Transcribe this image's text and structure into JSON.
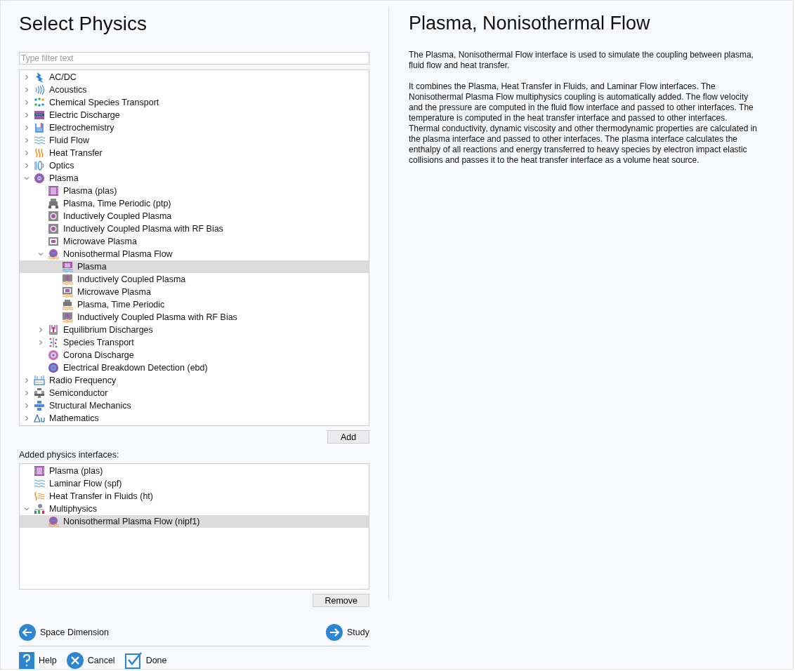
{
  "title": "Select Physics",
  "filter": {
    "placeholder": "Type filter text"
  },
  "tree": [
    {
      "label": "AC/DC",
      "kind": "bolt",
      "expanded": false,
      "selected": false
    },
    {
      "label": "Acoustics",
      "kind": "sound",
      "expanded": false,
      "selected": false
    },
    {
      "label": "Chemical Species Transport",
      "kind": "dots",
      "expanded": false,
      "selected": false
    },
    {
      "label": "Electric Discharge",
      "kind": "discharge",
      "expanded": false,
      "selected": false
    },
    {
      "label": "Electrochemistry",
      "kind": "beaker",
      "expanded": false,
      "selected": false
    },
    {
      "label": "Fluid Flow",
      "kind": "flow",
      "expanded": false,
      "selected": false
    },
    {
      "label": "Heat Transfer",
      "kind": "heat",
      "expanded": false,
      "selected": false
    },
    {
      "label": "Optics",
      "kind": "optics",
      "expanded": false,
      "selected": false
    },
    {
      "label": "Plasma",
      "kind": "plasma",
      "expanded": true,
      "selected": false,
      "children": [
        {
          "label": "Plasma (plas)",
          "kind": "chamber",
          "selected": false
        },
        {
          "label": "Plasma, Time Periodic (ptp)",
          "kind": "device",
          "selected": false
        },
        {
          "label": "Inductively Coupled Plasma",
          "kind": "coil",
          "selected": false
        },
        {
          "label": "Inductively Coupled Plasma with RF Bias",
          "kind": "coil",
          "selected": false
        },
        {
          "label": "Microwave Plasma",
          "kind": "microwave",
          "selected": false
        },
        {
          "label": "Nonisothermal Plasma Flow",
          "kind": "plasmaflow",
          "expanded": true,
          "selected": false,
          "children": [
            {
              "label": "Plasma",
              "kind": "chamberflow",
              "selected": true
            },
            {
              "label": "Inductively Coupled Plasma",
              "kind": "coilflow",
              "selected": false
            },
            {
              "label": "Microwave Plasma",
              "kind": "microwaveflow",
              "selected": false
            },
            {
              "label": "Plasma, Time Periodic",
              "kind": "deviceflow",
              "selected": false
            },
            {
              "label": "Inductively Coupled Plasma with RF Bias",
              "kind": "coilflow",
              "selected": false
            }
          ]
        },
        {
          "label": "Equilibrium Discharges",
          "kind": "torch",
          "expanded": false,
          "selected": false
        },
        {
          "label": "Species Transport",
          "kind": "species",
          "expanded": false,
          "selected": false
        },
        {
          "label": "Corona Discharge",
          "kind": "corona",
          "selected": false
        },
        {
          "label": "Electrical Breakdown Detection (ebd)",
          "kind": "breakdown",
          "selected": false
        }
      ]
    },
    {
      "label": "Radio Frequency",
      "kind": "antenna",
      "expanded": false,
      "selected": false
    },
    {
      "label": "Semiconductor",
      "kind": "transistor",
      "expanded": false,
      "selected": false
    },
    {
      "label": "Structural Mechanics",
      "kind": "beam",
      "expanded": false,
      "selected": false
    },
    {
      "label": "Mathematics",
      "kind": "delta",
      "expanded": false,
      "selected": false
    }
  ],
  "add_button": "Add",
  "added_label": "Added physics interfaces:",
  "added": [
    {
      "label": "Plasma (plas)",
      "kind": "chamber",
      "selected": false
    },
    {
      "label": "Laminar Flow (spf)",
      "kind": "flow",
      "selected": false
    },
    {
      "label": "Heat Transfer in Fluids (ht)",
      "kind": "heatflow",
      "selected": false
    },
    {
      "label": "Multiphysics",
      "kind": "multi",
      "expanded": true,
      "selected": false,
      "children": [
        {
          "label": "Nonisothermal Plasma Flow (nipf1)",
          "kind": "plasmaflow",
          "selected": true
        }
      ]
    }
  ],
  "remove_button": "Remove",
  "back_button": "Space Dimension",
  "next_button": "Study",
  "help_button": "Help",
  "cancel_button": "Cancel",
  "done_button": "Done",
  "heading": "Plasma, Nonisothermal Flow",
  "paragraphs": [
    "The Plasma, Nonisothermal Flow interface is used to simulate the coupling between plasma, fluid flow and heat transfer.",
    "It combines the Plasma, Heat Transfer in Fluids, and Laminar Flow interfaces. The Nonisothermal Plasma Flow multiphysics coupling is automatically added. The flow velocity and the pressure are computed in the fluid flow interface and passed to other interfaces. The temperature is computed in the heat transfer interface and passed to other interfaces. Thermal conductivity, dynamic viscosity and other thermodynamic properties are calculated in the plasma interface and passed to other interfaces. The plasma interface calculates the enthalpy of all reactions and energy transferred to heavy species by electron impact elastic collisions and passes it to the heat transfer interface as a volume heat source."
  ]
}
